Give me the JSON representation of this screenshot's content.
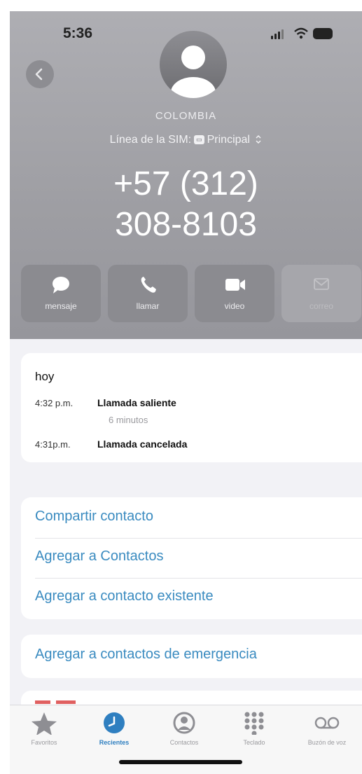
{
  "status_bar": {
    "time": "5:36"
  },
  "contact": {
    "country": "COLOMBIA",
    "sim_label": "Línea de la SIM:",
    "sim_name": "Principal",
    "phone_line1": "+57 (312)",
    "phone_line2": "308-8103"
  },
  "actions": [
    {
      "label": "mensaje",
      "icon": "message-icon",
      "enabled": true
    },
    {
      "label": "llamar",
      "icon": "phone-icon",
      "enabled": true
    },
    {
      "label": "video",
      "icon": "video-icon",
      "enabled": true
    },
    {
      "label": "correo",
      "icon": "mail-icon",
      "enabled": false
    }
  ],
  "history": {
    "title": "hoy",
    "entries": [
      {
        "time": "4:32 p.m.",
        "type": "Llamada saliente",
        "duration": "6 minutos"
      },
      {
        "time": "4:31p.m.",
        "type": "Llamada cancelada"
      }
    ]
  },
  "options": [
    "Compartir contacto",
    "Agregar a Contactos",
    "Agregar a contacto existente"
  ],
  "emergency_option": "Agregar a contactos de emergencia",
  "tabs": [
    {
      "label": "Favoritos",
      "icon": "star-icon",
      "active": false
    },
    {
      "label": "Recientes",
      "icon": "clock-icon",
      "active": true
    },
    {
      "label": "Contactos",
      "icon": "person-circle-icon",
      "active": false
    },
    {
      "label": "Teclado",
      "icon": "keypad-icon",
      "active": false
    },
    {
      "label": "Buzón de voz",
      "icon": "voicemail-icon",
      "active": false
    }
  ],
  "colors": {
    "header_bg": "#a6a6ab",
    "link": "#3a8bc0",
    "tab_active": "#2f7fc0",
    "tab_inactive": "#8e8e93"
  }
}
